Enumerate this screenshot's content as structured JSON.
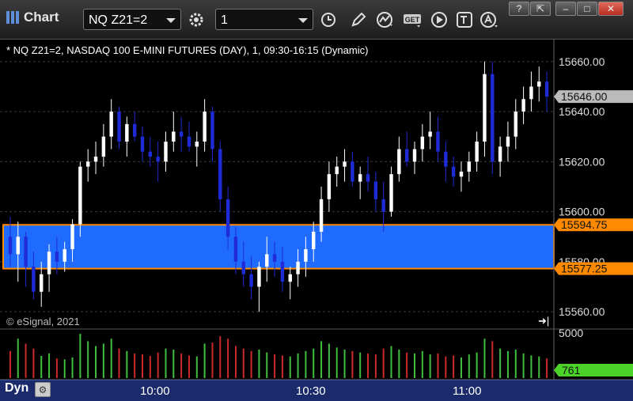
{
  "app": {
    "title": "Chart"
  },
  "toolbar": {
    "symbol": "NQ Z21=2",
    "interval": "1",
    "buttons": [
      "gear-icon",
      "clock-icon",
      "pencil-icon",
      "study-icon",
      "get-icon",
      "play-icon",
      "text-icon",
      "alert-icon"
    ]
  },
  "window_controls": [
    "help",
    "restore",
    "minimize",
    "maximize",
    "close"
  ],
  "chart_header": "* NQ Z21=2, NASDAQ 100 E-MINI FUTURES (DAY), 1, 09:30-16:15 (Dynamic)",
  "copyright": "© eSignal, 2021",
  "footer": {
    "mode": "Dyn",
    "time_labels": [
      "10:00",
      "10:30",
      "11:00"
    ]
  },
  "price_axis": {
    "labels": [
      "15660.00",
      "15640.00",
      "15620.00",
      "15600.00",
      "15580.00",
      "15560.00"
    ]
  },
  "volume_axis": {
    "label": "5000",
    "last_volume": "761"
  },
  "markers": {
    "last_price": "15646.00",
    "zone_high": "15594.75",
    "zone_low": "15577.25"
  },
  "colors": {
    "up": "#ffffff",
    "down": "#1e2bd6",
    "zone_fill": "#1f6bff",
    "zone_border": "#ff8a00",
    "vol_up": "#3fbf3f",
    "vol_down": "#cc2a2a",
    "volume_badge": "#4bd32a",
    "price_badge": "#bbbbbb",
    "footer_bg": "#1b2a6b"
  },
  "chart_data": {
    "type": "candlestick",
    "ylim": [
      15555,
      15665
    ],
    "zone": [
      15577.25,
      15594.75
    ],
    "candles": [
      [
        15590,
        15598,
        15578,
        15583
      ],
      [
        15583,
        15596,
        15572,
        15590
      ],
      [
        15590,
        15592,
        15570,
        15578
      ],
      [
        15578,
        15584,
        15565,
        15568
      ],
      [
        15568,
        15580,
        15562,
        15575
      ],
      [
        15575,
        15587,
        15568,
        15584
      ],
      [
        15584,
        15590,
        15575,
        15580
      ],
      [
        15580,
        15588,
        15576,
        15585
      ],
      [
        15585,
        15597,
        15580,
        15595
      ],
      [
        15595,
        15620,
        15590,
        15618
      ],
      [
        15618,
        15625,
        15612,
        15620
      ],
      [
        15620,
        15628,
        15615,
        15622
      ],
      [
        15622,
        15635,
        15618,
        15630
      ],
      [
        15630,
        15645,
        15625,
        15640
      ],
      [
        15640,
        15642,
        15625,
        15628
      ],
      [
        15628,
        15638,
        15622,
        15635
      ],
      [
        15635,
        15640,
        15628,
        15630
      ],
      [
        15630,
        15634,
        15620,
        15624
      ],
      [
        15624,
        15630,
        15618,
        15622
      ],
      [
        15622,
        15628,
        15612,
        15620
      ],
      [
        15620,
        15632,
        15616,
        15628
      ],
      [
        15628,
        15640,
        15624,
        15632
      ],
      [
        15632,
        15638,
        15624,
        15630
      ],
      [
        15630,
        15636,
        15624,
        15626
      ],
      [
        15626,
        15632,
        15618,
        15628
      ],
      [
        15628,
        15645,
        15624,
        15640
      ],
      [
        15640,
        15642,
        15620,
        15625
      ],
      [
        15625,
        15628,
        15600,
        15605
      ],
      [
        15605,
        15610,
        15585,
        15590
      ],
      [
        15590,
        15594,
        15575,
        15580
      ],
      [
        15580,
        15588,
        15570,
        15575
      ],
      [
        15575,
        15582,
        15565,
        15570
      ],
      [
        15570,
        15580,
        15560,
        15578
      ],
      [
        15578,
        15590,
        15572,
        15583
      ],
      [
        15583,
        15588,
        15574,
        15580
      ],
      [
        15580,
        15586,
        15568,
        15572
      ],
      [
        15572,
        15578,
        15565,
        15575
      ],
      [
        15575,
        15585,
        15570,
        15580
      ],
      [
        15580,
        15590,
        15574,
        15585
      ],
      [
        15585,
        15596,
        15580,
        15592
      ],
      [
        15592,
        15610,
        15588,
        15605
      ],
      [
        15605,
        15620,
        15600,
        15615
      ],
      [
        15615,
        15622,
        15610,
        15618
      ],
      [
        15618,
        15625,
        15612,
        15620
      ],
      [
        15620,
        15624,
        15610,
        15612
      ],
      [
        15612,
        15618,
        15605,
        15615
      ],
      [
        15615,
        15622,
        15608,
        15612
      ],
      [
        15612,
        15616,
        15600,
        15605
      ],
      [
        15605,
        15612,
        15592,
        15600
      ],
      [
        15600,
        15618,
        15598,
        15615
      ],
      [
        15615,
        15630,
        15612,
        15625
      ],
      [
        15625,
        15632,
        15618,
        15620
      ],
      [
        15620,
        15628,
        15615,
        15625
      ],
      [
        15625,
        15635,
        15620,
        15630
      ],
      [
        15630,
        15640,
        15625,
        15632
      ],
      [
        15632,
        15638,
        15620,
        15624
      ],
      [
        15624,
        15628,
        15612,
        15618
      ],
      [
        15618,
        15622,
        15610,
        15614
      ],
      [
        15614,
        15620,
        15608,
        15616
      ],
      [
        15616,
        15624,
        15612,
        15620
      ],
      [
        15620,
        15632,
        15616,
        15628
      ],
      [
        15628,
        15660,
        15622,
        15655
      ],
      [
        15655,
        15660,
        15615,
        15620
      ],
      [
        15620,
        15630,
        15614,
        15626
      ],
      [
        15626,
        15636,
        15620,
        15630
      ],
      [
        15630,
        15645,
        15625,
        15640
      ],
      [
        15640,
        15650,
        15635,
        15645
      ],
      [
        15645,
        15656,
        15640,
        15650
      ],
      [
        15650,
        15658,
        15644,
        15652
      ],
      [
        15652,
        15656,
        15640,
        15646
      ]
    ],
    "volume": [
      55,
      80,
      70,
      60,
      45,
      50,
      40,
      38,
      42,
      90,
      75,
      65,
      70,
      80,
      60,
      55,
      50,
      48,
      45,
      52,
      60,
      58,
      50,
      46,
      44,
      70,
      72,
      85,
      80,
      65,
      60,
      55,
      58,
      52,
      48,
      46,
      44,
      50,
      55,
      60,
      75,
      70,
      62,
      58,
      55,
      52,
      50,
      48,
      60,
      65,
      58,
      52,
      50,
      55,
      48,
      50,
      44,
      46,
      42,
      48,
      52,
      80,
      75,
      60,
      55,
      58,
      50,
      46,
      44,
      40
    ]
  }
}
